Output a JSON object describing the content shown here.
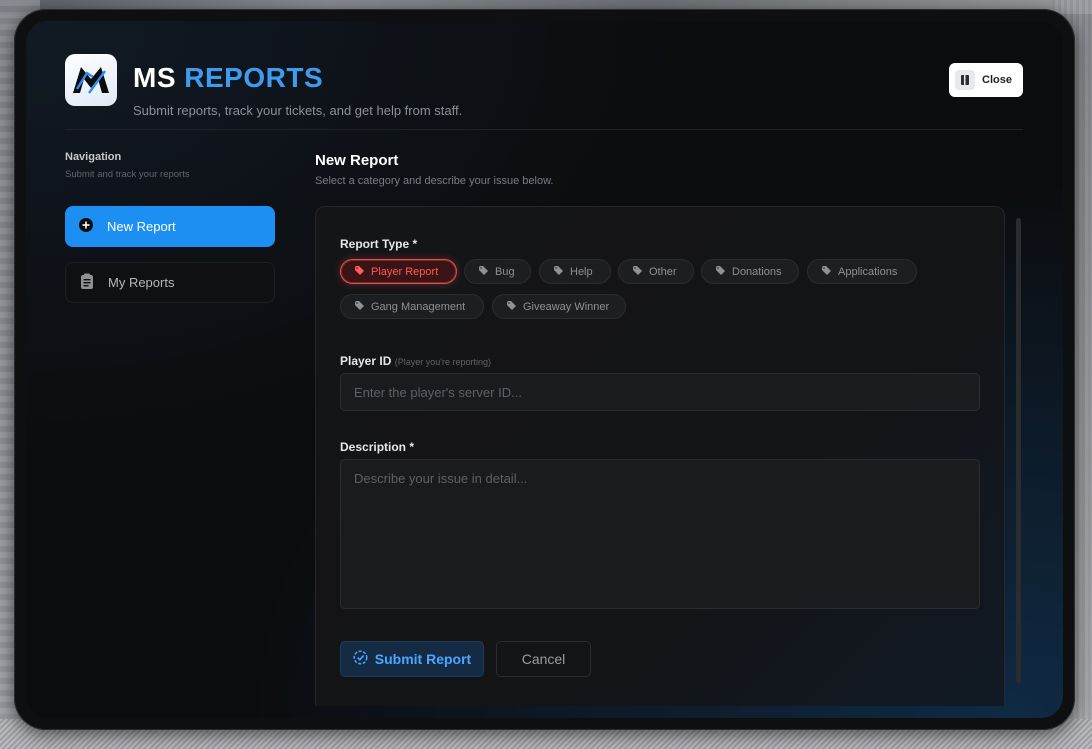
{
  "app": {
    "title_part1": "MS",
    "title_part2": "REPORTS",
    "subtitle": "Submit reports, track your tickets, and get help from staff.",
    "close_label": "Close",
    "accent_color": "#1e8ff2",
    "active_chip_color": "#e84a4a"
  },
  "sidebar": {
    "title": "Navigation",
    "subtitle": "Submit and track your reports",
    "items": [
      {
        "label": "New Report",
        "icon": "plus-circle-icon",
        "active": true
      },
      {
        "label": "My Reports",
        "icon": "clipboard-icon",
        "active": false
      }
    ]
  },
  "main": {
    "title": "New Report",
    "subtitle": "Select a category and describe your issue below.",
    "report_type": {
      "label": "Report Type *",
      "selected": "Player Report",
      "options": [
        "Player Report",
        "Bug",
        "Help",
        "Other",
        "Donations",
        "Applications",
        "Gang Management",
        "Giveaway Winner"
      ]
    },
    "player_id": {
      "label": "Player ID",
      "hint": "(Player you're reporting)",
      "placeholder": "Enter the player's server ID...",
      "value": ""
    },
    "description": {
      "label": "Description *",
      "placeholder": "Describe your issue in detail...",
      "value": ""
    },
    "submit_label": "Submit Report",
    "cancel_label": "Cancel"
  }
}
